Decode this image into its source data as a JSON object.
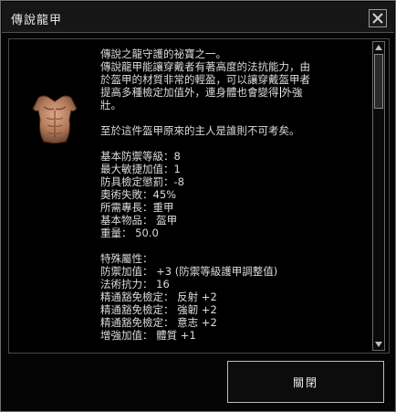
{
  "window": {
    "title": "傳說龍甲"
  },
  "item": {
    "description": [
      "傳說之龍守護的祕寶之一。",
      "傳說龍甲能讓穿戴者有著高度的法抗能力，由",
      "於盔甲的材質非常的輕盈，可以讓穿戴盔甲者",
      "提高多種檢定加值外，連身體也會變得"
    ],
    "description_after_caret": "外強",
    "description_last": "壯。",
    "lore": "至於這件盔甲原來的主人是誰則不可考矣。",
    "base_stats": [
      "基本防禦等級：8",
      "最大敏捷加值：1",
      "防具檢定懲罰：-8",
      "奧術失敗：45%",
      "所需專長：重甲",
      "基本物品： 盔甲",
      "重量： 50.0"
    ],
    "special_header": "特殊屬性：",
    "special_properties": [
      "防禦加值： +3 (防禦等級護甲調整值)",
      "法術抗力： 16",
      "精通豁免檢定： 反射 +2",
      "精通豁免檢定： 強韌 +2",
      "精通豁免檢定： 意志 +2",
      "增強加值： 體質 +1"
    ]
  },
  "footer": {
    "ok_label": "關閉"
  },
  "icons": {
    "close": "close-icon",
    "scroll_up": "arrow-up-icon",
    "scroll_down": "arrow-down-icon",
    "item": "armor-breastplate-icon"
  },
  "colors": {
    "text": "#dcdcdc",
    "armor": "#b07a5a"
  }
}
